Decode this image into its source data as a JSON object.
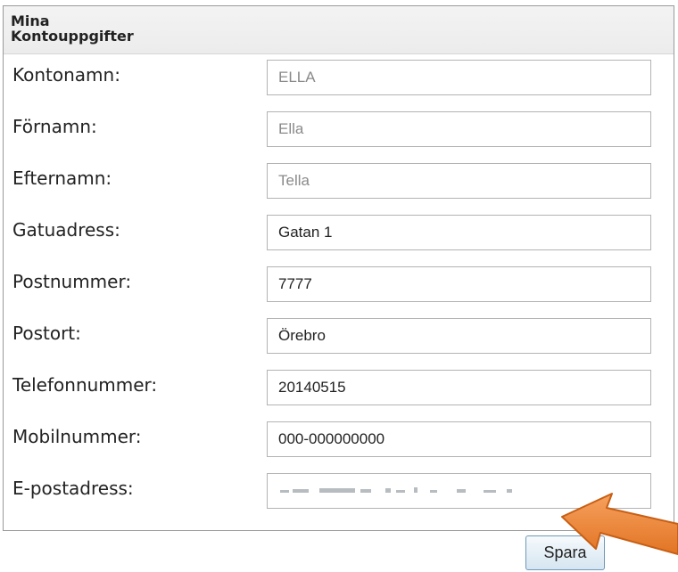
{
  "form": {
    "title": "Mina Kontouppgifter",
    "title_line1": "Mina",
    "title_line2": "Kontouppgifter",
    "fields": [
      {
        "label": "Kontonamn:",
        "value": "ELLA",
        "readonly": true
      },
      {
        "label": "Förnamn:",
        "value": "Ella",
        "readonly": true
      },
      {
        "label": "Efternamn:",
        "value": "Tella",
        "readonly": true
      },
      {
        "label": "Gatuadress:",
        "value": "Gatan 1",
        "readonly": false
      },
      {
        "label": "Postnummer:",
        "value": "7777",
        "readonly": false
      },
      {
        "label": "Postort:",
        "value": "Örebro",
        "readonly": false
      },
      {
        "label": "Telefonnummer:",
        "value": "20140515",
        "readonly": false
      },
      {
        "label": "Mobilnummer:",
        "value": "000-000000000",
        "readonly": false
      },
      {
        "label": "E-postadress:",
        "value": "",
        "readonly": false
      }
    ],
    "save_label": "Spara"
  },
  "annotation": {
    "arrow_color": "#f0883a",
    "arrow_points_to": "E-postadress field"
  },
  "colors": {
    "header_bg": "#efefef",
    "button_bg": "#dbe8f2",
    "button_border": "#6f98b8"
  }
}
